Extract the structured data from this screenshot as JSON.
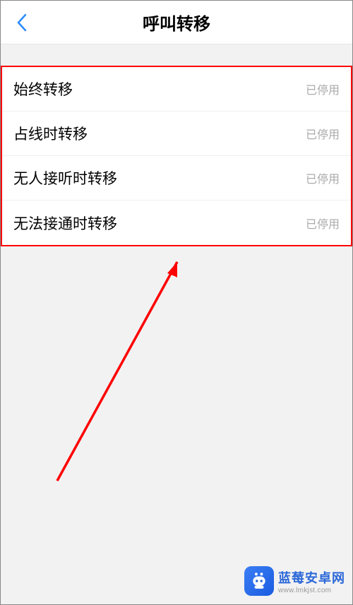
{
  "header": {
    "title": "呼叫转移"
  },
  "list": {
    "items": [
      {
        "label": "始终转移",
        "status": "已停用"
      },
      {
        "label": "占线时转移",
        "status": "已停用"
      },
      {
        "label": "无人接听时转移",
        "status": "已停用"
      },
      {
        "label": "无法接通时转移",
        "status": "已停用"
      }
    ]
  },
  "watermark": {
    "title": "蓝莓安卓网",
    "url": "www.lmkjst.com"
  }
}
